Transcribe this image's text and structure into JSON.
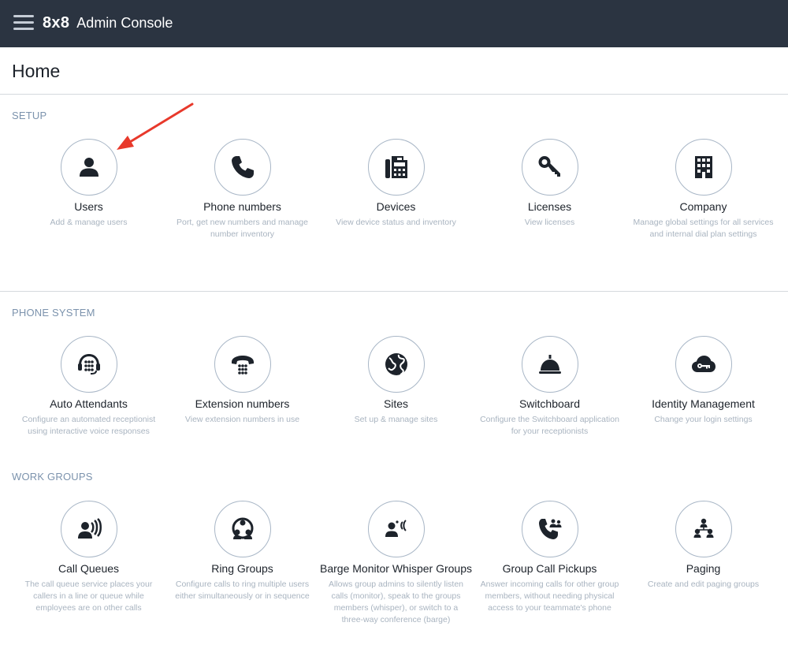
{
  "header": {
    "logo": "8x8",
    "title": "Admin Console"
  },
  "page": {
    "title": "Home"
  },
  "sections": [
    {
      "title": "SETUP",
      "tiles": [
        {
          "icon": "user-icon",
          "title": "Users",
          "desc": "Add & manage users"
        },
        {
          "icon": "phone-icon",
          "title": "Phone numbers",
          "desc": "Port, get new numbers and manage number inventory"
        },
        {
          "icon": "desk-phone-icon",
          "title": "Devices",
          "desc": "View device status and inventory"
        },
        {
          "icon": "key-icon",
          "title": "Licenses",
          "desc": "View licenses"
        },
        {
          "icon": "building-icon",
          "title": "Company",
          "desc": "Manage global settings for all services and internal dial plan settings"
        }
      ]
    },
    {
      "title": "PHONE SYSTEM",
      "tiles": [
        {
          "icon": "headset-keypad-icon",
          "title": "Auto Attendants",
          "desc": "Configure an automated receptionist using interactive voice responses"
        },
        {
          "icon": "phone-keypad-icon",
          "title": "Extension numbers",
          "desc": "View extension numbers in use"
        },
        {
          "icon": "globe-icon",
          "title": "Sites",
          "desc": "Set up & manage sites"
        },
        {
          "icon": "service-bell-icon",
          "title": "Switchboard",
          "desc": "Configure the Switchboard application for your receptionists"
        },
        {
          "icon": "cloud-key-icon",
          "title": "Identity Management",
          "desc": "Change your login settings"
        }
      ]
    },
    {
      "title": "WORK GROUPS",
      "tiles": [
        {
          "icon": "call-queue-icon",
          "title": "Call Queues",
          "desc": "The call queue service places your callers in a line or queue while employees are on other calls"
        },
        {
          "icon": "ring-group-icon",
          "title": "Ring Groups",
          "desc": "Configure calls to ring multiple users either simultaneously or in sequence"
        },
        {
          "icon": "barge-monitor-icon",
          "title": "Barge Monitor Whisper Groups",
          "desc": "Allows group admins to silently listen calls (monitor), speak to the groups members (whisper), or switch to a three-way conference (barge)"
        },
        {
          "icon": "group-pickup-icon",
          "title": "Group Call Pickups",
          "desc": "Answer incoming calls for other group members, without needing physical access to your teammate's phone"
        },
        {
          "icon": "paging-icon",
          "title": "Paging",
          "desc": "Create and edit paging groups"
        }
      ]
    }
  ],
  "colors": {
    "header_bg": "#2b3441",
    "section_title": "#7c93ad",
    "description": "#a9b4c0",
    "annotation_arrow": "#e8392b"
  }
}
